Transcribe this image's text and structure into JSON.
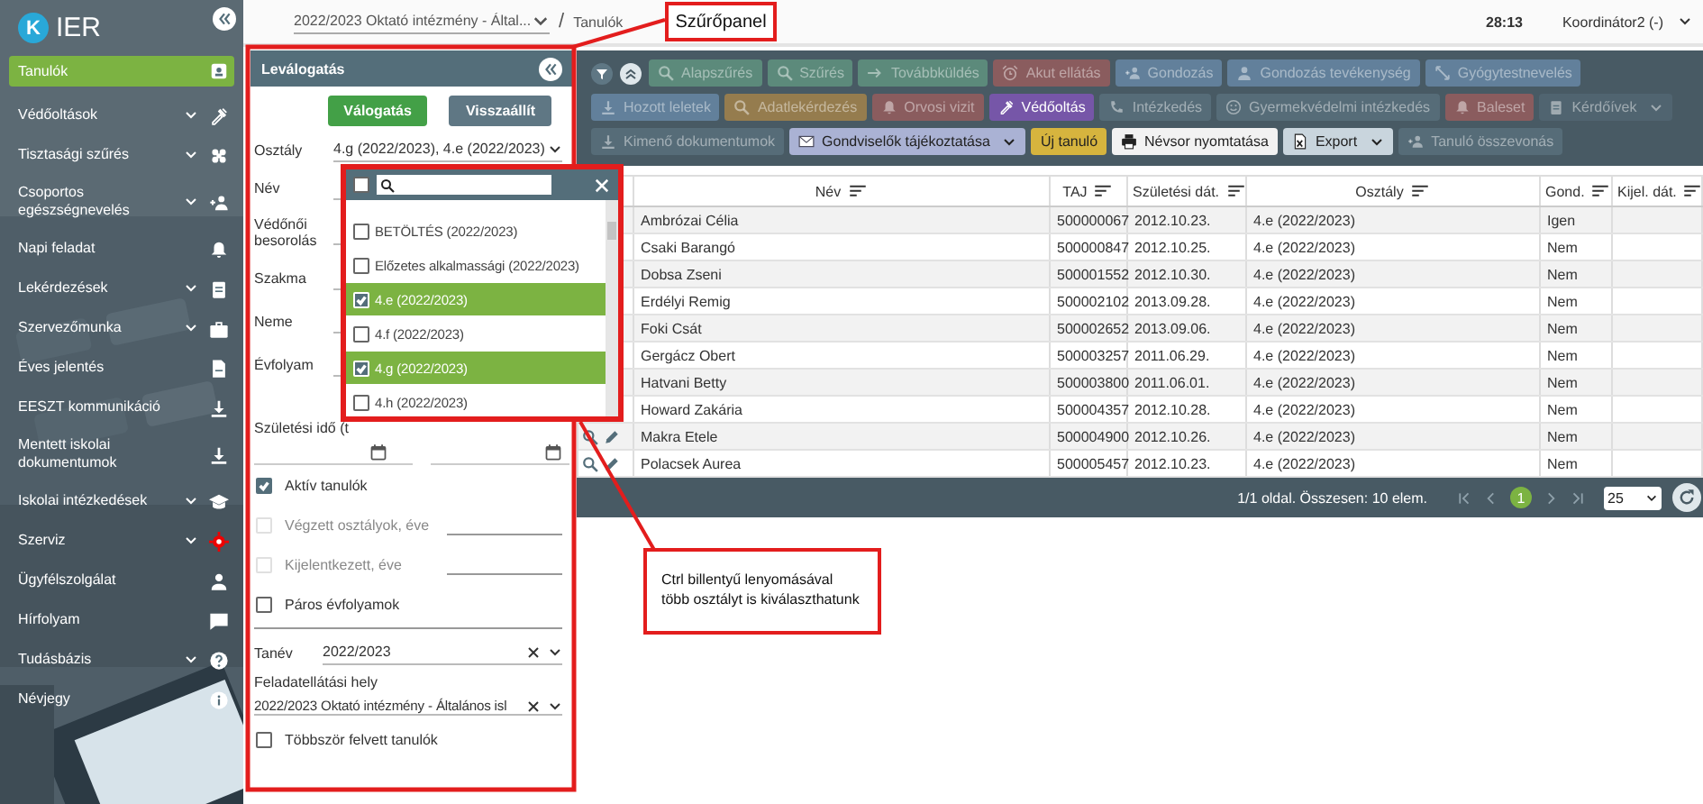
{
  "sidebar": {
    "logo_letter": "K",
    "logo_text": "IER",
    "items": [
      {
        "label": "Tanulók",
        "selected": true,
        "submenu": false
      },
      {
        "label": "Védőoltások",
        "selected": false,
        "submenu": true
      },
      {
        "label": "Tisztasági szűrés",
        "selected": false,
        "submenu": true
      },
      {
        "label": "Csoportos egészségnevelés",
        "selected": false,
        "submenu": true
      },
      {
        "label": "Napi feladat",
        "selected": false,
        "submenu": false
      },
      {
        "label": "Lekérdezések",
        "selected": false,
        "submenu": true
      },
      {
        "label": "Szervezőmunka",
        "selected": false,
        "submenu": true
      },
      {
        "label": "Éves jelentés",
        "selected": false,
        "submenu": false
      },
      {
        "label": "EESZT kommunikáció",
        "selected": false,
        "submenu": false
      },
      {
        "label": "Mentett iskolai dokumentumok",
        "selected": false,
        "submenu": false
      },
      {
        "label": "Iskolai intézkedések",
        "selected": false,
        "submenu": true
      },
      {
        "label": "Szerviz",
        "selected": false,
        "submenu": true
      },
      {
        "label": "Ügyfélszolgálat",
        "selected": false,
        "submenu": false
      },
      {
        "label": "Hírfolyam",
        "selected": false,
        "submenu": false
      },
      {
        "label": "Tudásbázis",
        "selected": false,
        "submenu": true
      },
      {
        "label": "Névjegy",
        "selected": false,
        "submenu": false
      }
    ]
  },
  "topbar": {
    "institution": "2022/2023 Oktató intézmény - Által...",
    "separator": "/",
    "page": "Tanulók",
    "timer": "28:13",
    "user": "Koordinátor2 (-)"
  },
  "filter_panel": {
    "title": "Leválogatás",
    "buttons": [
      {
        "label": "Válogatás",
        "kind": "primary"
      },
      {
        "label": "Visszaállít",
        "kind": "secondary"
      }
    ],
    "fields": [
      {
        "kind": "select",
        "label": "Osztály",
        "value": "4.g (2022/2023), 4.e (2022/2023)"
      },
      {
        "kind": "text",
        "label": "Név"
      },
      {
        "kind": "select",
        "label": "Védőnői besorolás"
      },
      {
        "kind": "select",
        "label": "Szakma"
      },
      {
        "kind": "select",
        "label": "Neme"
      },
      {
        "kind": "select",
        "label": "Évfolyam"
      },
      {
        "kind": "date_range",
        "label": "Születési idő (t"
      }
    ],
    "options": [
      {
        "label": "Aktív tanulók",
        "checked": true,
        "disabled": false,
        "year_field": false
      },
      {
        "label": "Végzett osztályok, éve",
        "checked": false,
        "disabled": true,
        "year_field": true
      },
      {
        "label": "Kijelentkezett, éve",
        "checked": false,
        "disabled": true,
        "year_field": true
      },
      {
        "label": "Páros évfolyamok",
        "checked": false,
        "disabled": false,
        "year_field": false
      }
    ],
    "selects": [
      {
        "kind": "inline",
        "label": "Tanév",
        "value": "2022/2023"
      },
      {
        "kind": "stacked",
        "label": "Feladatellátási hely",
        "value": "2022/2023 Oktató intézmény - Általános isl"
      }
    ],
    "last_option": {
      "label": "Többször felvett tanulók",
      "checked": false
    }
  },
  "class_dropdown": {
    "all_checked": false,
    "items": [
      {
        "label": "BETÖLTÉS (2022/2023)",
        "checked": false
      },
      {
        "label": "Előzetes alkalmassági (2022/2023)",
        "checked": false
      },
      {
        "label": "4.e (2022/2023)",
        "checked": true
      },
      {
        "label": "4.f (2022/2023)",
        "checked": false
      },
      {
        "label": "4.g (2022/2023)",
        "checked": true
      },
      {
        "label": "4.h (2022/2023)",
        "checked": false
      }
    ]
  },
  "toolbar": {
    "rows": [
      {
        "buttons": [
          {
            "label": "Alapszűrés",
            "color": "#5c8a7b",
            "disabled": true,
            "dropdown": false
          },
          {
            "label": "Szűrés",
            "color": "#5c8a7b",
            "disabled": true,
            "dropdown": false
          },
          {
            "label": "Továbbküldés",
            "color": "#5c8a7b",
            "disabled": true,
            "dropdown": false
          },
          {
            "label": "Akut ellátás",
            "color": "#8a5c5e",
            "disabled": true,
            "dropdown": false
          },
          {
            "label": "Gondozás",
            "color": "#62809b",
            "disabled": true,
            "dropdown": false
          },
          {
            "label": "Gondozás tevékenység",
            "color": "#62809b",
            "disabled": true,
            "dropdown": false
          },
          {
            "label": "Gyógytestnevelés",
            "color": "#62809b",
            "disabled": true,
            "dropdown": false
          }
        ]
      },
      {
        "buttons": [
          {
            "label": "Hozott leletek",
            "color": "#62809b",
            "disabled": true,
            "dropdown": false
          },
          {
            "label": "Adatlekérdezés",
            "color": "#957c4e",
            "disabled": true,
            "dropdown": false
          },
          {
            "label": "Orvosi vizit",
            "color": "#8a5c5e",
            "disabled": true,
            "dropdown": false
          },
          {
            "label": "Védőoltás",
            "color": "#7656a8",
            "disabled": false,
            "dropdown": false
          },
          {
            "label": "Intézkedés",
            "color": "#566c78",
            "disabled": true,
            "dropdown": false
          },
          {
            "label": "Gyermekvédelmi intézkedés",
            "color": "#566c78",
            "disabled": true,
            "dropdown": false
          },
          {
            "label": "Baleset",
            "color": "#8a5c5e",
            "disabled": true,
            "dropdown": false
          },
          {
            "label": "Kérdőívek",
            "color": "#506470",
            "disabled": true,
            "dropdown": true
          }
        ]
      },
      {
        "buttons": [
          {
            "label": "Kimenő dokumentumok",
            "color": "#566c78",
            "disabled": true,
            "dropdown": false
          },
          {
            "label": "Gondviselők tájékoztatása",
            "color": "#aab2d4",
            "disabled": false,
            "dropdown": true
          },
          {
            "label": "Új tanuló",
            "color": "#d6b43e",
            "disabled": false,
            "dropdown": false
          },
          {
            "label": "Névsor nyomtatása",
            "color": "#f2f2f2",
            "disabled": false,
            "dropdown": false
          },
          {
            "label": "Export",
            "color": "#c9d5dd",
            "disabled": false,
            "dropdown": true
          },
          {
            "label": "Tanuló összevonás",
            "color": "#566c78",
            "disabled": true,
            "dropdown": false
          }
        ]
      }
    ]
  },
  "table": {
    "columns": [
      "Név",
      "TAJ",
      "Születési dát.",
      "Osztály",
      "Gond.",
      "Kijel. dát."
    ],
    "rows": [
      {
        "name": "Ambrózai Célia",
        "taj": "500000067",
        "birth": "2012.10.23.",
        "class": "4.e (2022/2023)",
        "guardian": "Igen"
      },
      {
        "name": "Csaki Barangó",
        "taj": "500000847",
        "birth": "2012.10.25.",
        "class": "4.e (2022/2023)",
        "guardian": "Nem"
      },
      {
        "name": "Dobsa Zseni",
        "taj": "500001552",
        "birth": "2012.10.30.",
        "class": "4.e (2022/2023)",
        "guardian": "Nem"
      },
      {
        "name": "Erdélyi Remig",
        "taj": "500002102",
        "birth": "2013.09.28.",
        "class": "4.e (2022/2023)",
        "guardian": "Nem"
      },
      {
        "name": "Foki Csát",
        "taj": "500002652",
        "birth": "2013.09.06.",
        "class": "4.e (2022/2023)",
        "guardian": "Nem"
      },
      {
        "name": "Gergácz Obert",
        "taj": "500003257",
        "birth": "2011.06.29.",
        "class": "4.e (2022/2023)",
        "guardian": "Nem"
      },
      {
        "name": "Hatvani Betty",
        "taj": "500003800",
        "birth": "2011.06.01.",
        "class": "4.e (2022/2023)",
        "guardian": "Nem"
      },
      {
        "name": "Howard Zakária",
        "taj": "500004357",
        "birth": "2012.10.28.",
        "class": "4.e (2022/2023)",
        "guardian": "Nem"
      },
      {
        "name": "Makra Etele",
        "taj": "500004900",
        "birth": "2012.10.26.",
        "class": "4.e (2022/2023)",
        "guardian": "Nem"
      },
      {
        "name": "Polacsek Aurea",
        "taj": "500005457",
        "birth": "2012.10.23.",
        "class": "4.e (2022/2023)",
        "guardian": "Nem"
      }
    ]
  },
  "pagination": {
    "summary": "1/1 oldal. Összesen: 10 elem.",
    "pages": [
      {
        "label": "1",
        "selected": true
      }
    ],
    "page_size": "25"
  },
  "annotations": {
    "callouts": [
      {
        "text": "Szűrőpanel"
      },
      {
        "text": "Ctrl billentyű lenyomásával több osztályt is kiválaszthatunk"
      }
    ]
  }
}
